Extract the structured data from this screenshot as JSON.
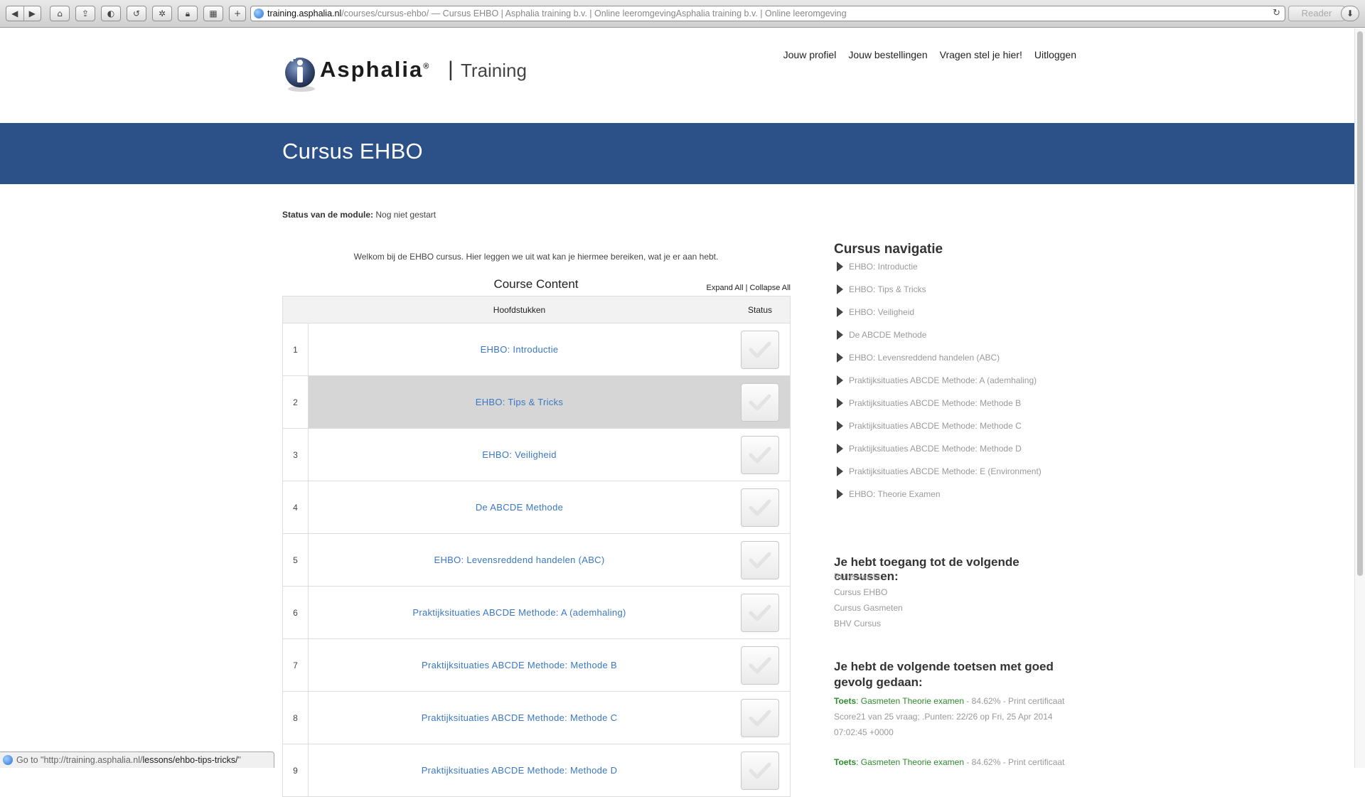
{
  "browser": {
    "url_host": "training.asphalia.nl",
    "url_path": "/courses/cursus-ehbo/",
    "url_title": " — Cursus EHBO | Asphalia training b.v. | Online leeromgevingAsphalia training b.v. | Online leeromgeving",
    "reader_label": "Reader",
    "status_prefix": "Go to \"http://training.asphalia.nl/",
    "status_path": "lessons/ehbo-tips-tricks/",
    "status_suffix": "\""
  },
  "header": {
    "logo_word": "Asphalia",
    "logo_reg": "®",
    "logo_sep": "|",
    "logo_sub": "Training",
    "nav": [
      "Jouw profiel",
      "Jouw bestellingen",
      "Vragen stel je hier!",
      "Uitloggen"
    ]
  },
  "banner": {
    "title": "Cursus EHBO"
  },
  "main": {
    "status_label": "Status van de module:",
    "status_value": " Nog niet gestart",
    "intro": "Welkom bij de EHBO cursus. Hier leggen we uit wat kan je hiermee bereiken, wat je er aan hebt.",
    "content_title": "Course Content",
    "expand_all": "Expand All",
    "separator": "|",
    "collapse_all": "Collapse All",
    "col_chapters": "Hoofdstukken",
    "col_status": "Status",
    "rows": [
      {
        "num": "1",
        "title": "EHBO: Introductie"
      },
      {
        "num": "2",
        "title": "EHBO: Tips & Tricks"
      },
      {
        "num": "3",
        "title": "EHBO: Veiligheid"
      },
      {
        "num": "4",
        "title": "De ABCDE Methode"
      },
      {
        "num": "5",
        "title": "EHBO: Levensreddend handelen (ABC)"
      },
      {
        "num": "6",
        "title": "Praktijksituaties ABCDE Methode: A (ademhaling)"
      },
      {
        "num": "7",
        "title": "Praktijksituaties ABCDE Methode: Methode B"
      },
      {
        "num": "8",
        "title": "Praktijksituaties ABCDE Methode: Methode C"
      },
      {
        "num": "9",
        "title": "Praktijksituaties ABCDE Methode: Methode D"
      }
    ]
  },
  "sidebar": {
    "nav_title": "Cursus navigatie",
    "nav_items": [
      "EHBO: Introductie",
      "EHBO: Tips & Tricks",
      "EHBO: Veiligheid",
      "De ABCDE Methode",
      "EHBO: Levensreddend handelen (ABC)",
      "Praktijksituaties ABCDE Methode: A (ademhaling)",
      "Praktijksituaties ABCDE Methode: Methode B",
      "Praktijksituaties ABCDE Methode: Methode C",
      "Praktijksituaties ABCDE Methode: Methode D",
      "Praktijksituaties ABCDE Methode: E (Environment)",
      "EHBO: Theorie Examen"
    ],
    "access_title": "Je hebt toegang tot de volgende cursussen:",
    "courses": [
      "Buitenwacht",
      "Cursus EHBO",
      "Cursus Gasmeten",
      "BHV Cursus"
    ],
    "tests_title": "Je hebt de volgende toetsen met goed gevolg gedaan:",
    "tests": [
      {
        "label": "Toets",
        "name": "Gasmeten Theorie examen",
        "score": " - 84.62% - Print certificaat",
        "details": "Score21 van 25 vraag; .Punten: 22/26 op Fri, 25 Apr 2014 07:02:45 +0000"
      },
      {
        "label": "Toets",
        "name": "Gasmeten Theorie examen",
        "score": " - 84.62% - Print certificaat",
        "details": ""
      }
    ]
  },
  "colors": {
    "banner": "#2c5189",
    "link": "#3a78c3",
    "green": "#2e8b2e"
  }
}
